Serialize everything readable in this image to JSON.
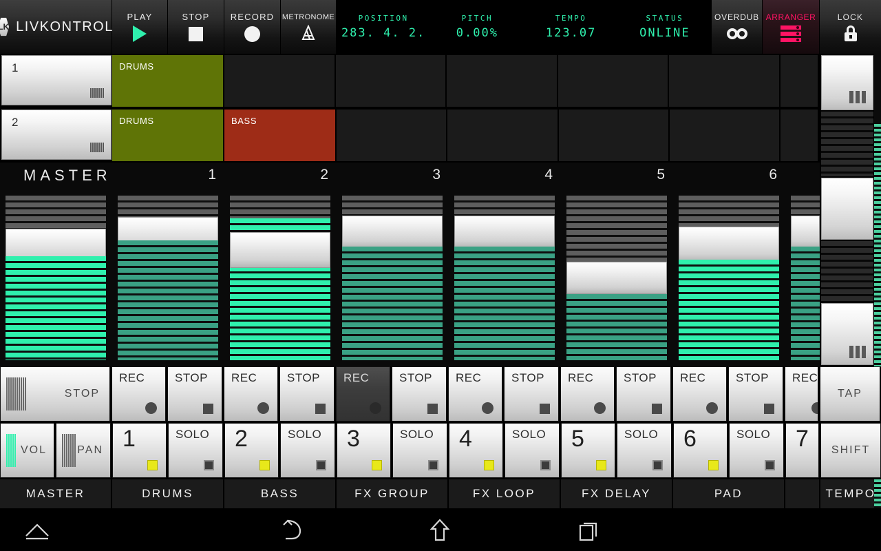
{
  "app": {
    "name": "LIVKONTROL",
    "logo_icon": "hexagon-lk-logo"
  },
  "transport": [
    {
      "label": "PLAY",
      "icon": "play-triangle-icon",
      "active": true
    },
    {
      "label": "STOP",
      "icon": "stop-square-icon",
      "active": false
    },
    {
      "label": "RECORD",
      "icon": "record-circle-icon",
      "active": false
    },
    {
      "label": "METRONOME",
      "icon": "metronome-icon",
      "active": false
    }
  ],
  "display": [
    {
      "key": "POSITION",
      "value": "283. 4. 2."
    },
    {
      "key": "PITCH",
      "value": "0.00%"
    },
    {
      "key": "TEMPO",
      "value": "123.07"
    },
    {
      "key": "STATUS",
      "value": "ONLINE"
    }
  ],
  "display_color": "#2ff0ad",
  "right_header": [
    {
      "label": "OVERDUB",
      "icon": "tape-reels-icon",
      "color": "#f2f2f2"
    },
    {
      "label": "ARRANGER",
      "icon": "arranger-bars-icon",
      "color": "#ff1464"
    },
    {
      "label": "LOCK",
      "icon": "padlock-icon",
      "color": "#f2f2f2"
    }
  ],
  "clip_grid": {
    "rows": [
      {
        "scene": "1",
        "scene_icon": "barcode-icon",
        "clips": [
          {
            "name": "DRUMS",
            "color": "#5f7406",
            "empty": false
          },
          {
            "name": "",
            "color": "#1b1b1b",
            "empty": true
          },
          {
            "name": "",
            "color": "#1b1b1b",
            "empty": true
          },
          {
            "name": "",
            "color": "#1b1b1b",
            "empty": true
          },
          {
            "name": "",
            "color": "#1b1b1b",
            "empty": true
          },
          {
            "name": "",
            "color": "#1b1b1b",
            "empty": true
          },
          {
            "name": "",
            "color": "#1b1b1b",
            "empty": true
          }
        ]
      },
      {
        "scene": "2",
        "scene_icon": "barcode-icon",
        "clips": [
          {
            "name": "DRUMS",
            "color": "#5f7406",
            "empty": false
          },
          {
            "name": "BASS",
            "color": "#9e2c17",
            "empty": false
          },
          {
            "name": "",
            "color": "#1b1b1b",
            "empty": true
          },
          {
            "name": "",
            "color": "#1b1b1b",
            "empty": true
          },
          {
            "name": "",
            "color": "#1b1b1b",
            "empty": true
          },
          {
            "name": "",
            "color": "#1b1b1b",
            "empty": true
          },
          {
            "name": "",
            "color": "#1b1b1b",
            "empty": true
          }
        ]
      }
    ]
  },
  "mixer": {
    "strips": [
      {
        "num": "MASTER",
        "name": "MASTER",
        "fader_pct": 63,
        "color": "#2ff0ad",
        "rec": null,
        "stop": "STOP",
        "solo": null,
        "armed": false,
        "solo_on": false
      },
      {
        "num": "1",
        "name": "DRUMS",
        "fader_pct": 73,
        "color": "#3aa184",
        "rec": "REC",
        "stop": "STOP",
        "solo": "SOLO",
        "armed": false,
        "solo_on": false
      },
      {
        "num": "2",
        "name": "BASS",
        "fader_pct": 58,
        "color": "#2ff0ad",
        "rec": "REC",
        "stop": "STOP",
        "solo": "SOLO",
        "armed": false,
        "solo_on": false
      },
      {
        "num": "3",
        "name": "FX GROUP",
        "fader_pct": 78,
        "color": "#3aa184",
        "rec": "REC",
        "stop": "STOP",
        "solo": "SOLO",
        "armed": true,
        "solo_on": false
      },
      {
        "num": "4",
        "name": "FX LOOP",
        "fader_pct": 78,
        "color": "#3aa184",
        "rec": "REC",
        "stop": "STOP",
        "solo": "SOLO",
        "armed": false,
        "solo_on": false
      },
      {
        "num": "5",
        "name": "FX DELAY",
        "fader_pct": 38,
        "color": "#3aa184",
        "rec": "REC",
        "stop": "STOP",
        "solo": "SOLO",
        "armed": false,
        "solo_on": false
      },
      {
        "num": "6",
        "name": "PAD",
        "fader_pct": 68,
        "color": "#2ff0ad",
        "rec": "REC",
        "stop": "STOP",
        "solo": "SOLO",
        "armed": false,
        "solo_on": false
      },
      {
        "num": "7",
        "name": "",
        "fader_pct": 66,
        "color": "#3aa184",
        "rec": "REC",
        "stop": "",
        "solo": "",
        "armed": false,
        "solo_on": false
      }
    ],
    "vol_label": "VOL",
    "pan_label": "PAN",
    "vol_icon": "fader-stripes-icon",
    "pan_icon": "fader-stripes-icon",
    "vol_active": true
  },
  "right_column": {
    "tap_label": "TAP",
    "shift_label": "SHIFT",
    "tempo_label": "TEMPO",
    "scene_launch_icon": "three-bars-icon",
    "scrollbar_color": "#4bcf9e"
  },
  "navbar": [
    {
      "icon": "menu-up-chevron-icon"
    },
    {
      "icon": "back-arrow-icon"
    },
    {
      "icon": "home-up-arrow-icon"
    },
    {
      "icon": "recents-icon"
    }
  ]
}
